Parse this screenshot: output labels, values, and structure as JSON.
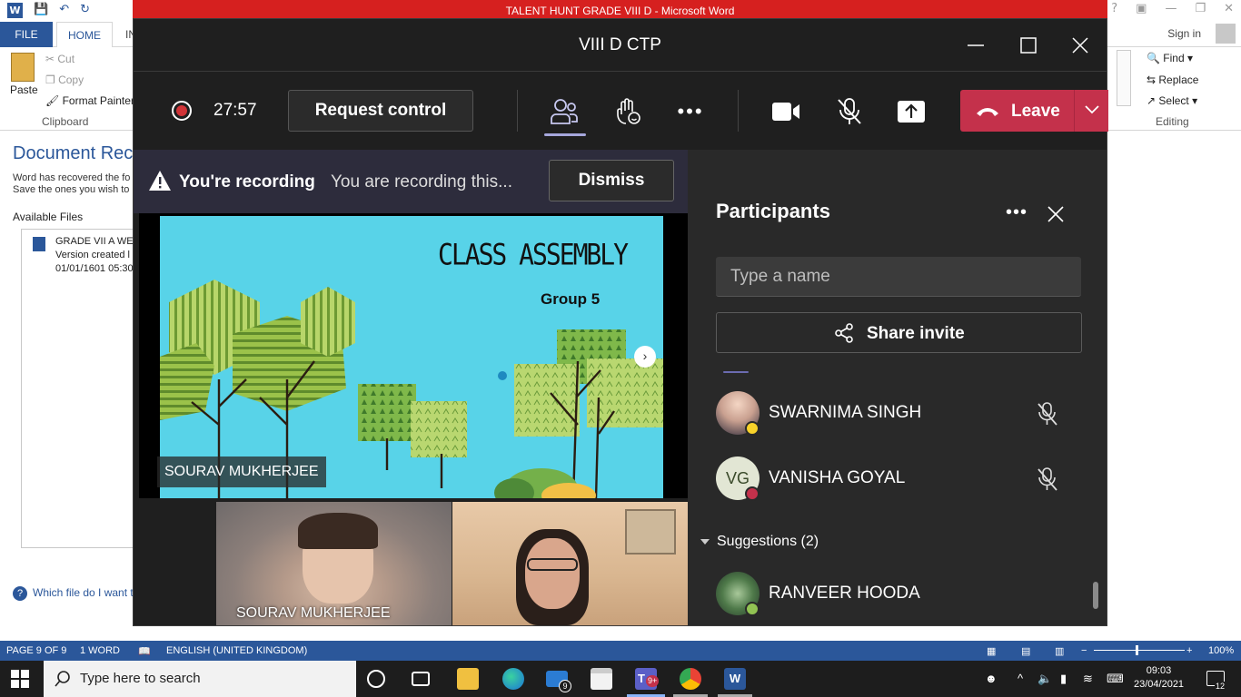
{
  "word": {
    "title": "TALENT HUNT GRADE VIII D -  Microsoft Word",
    "tabs": {
      "file": "FILE",
      "home": "HOME",
      "insert_partial": "IN"
    },
    "signin": "Sign in",
    "clipboard": {
      "paste": "Paste",
      "cut": "Cut",
      "copy": "Copy",
      "format_painter": "Format Painter",
      "group_label": "Clipboard"
    },
    "editing": {
      "find": "Find",
      "replace": "Replace",
      "select": "Select",
      "group_label": "Editing"
    },
    "recovery": {
      "title": "Document Rec",
      "text_line1": "Word has recovered the fo",
      "text_line2": "Save the ones you wish to",
      "available": "Available Files",
      "file_name": "GRADE VII A WEE",
      "file_version": "Version created l",
      "file_date": "01/01/1601 05:30",
      "help": "Which file do I want t"
    },
    "status": {
      "page": "PAGE 9 OF 9",
      "words": "1 WORD",
      "language": "ENGLISH (UNITED KINGDOM)",
      "zoom": "100%"
    }
  },
  "teams": {
    "window_title": "VIII D CTP",
    "timer": "27:57",
    "request_control": "Request control",
    "leave": "Leave",
    "recording_banner": {
      "bold": "You're recording",
      "text": "You are recording this...",
      "dismiss": "Dismiss"
    },
    "slide": {
      "title": "CLASS ASSEMBLY",
      "subtitle": "Group 5",
      "presenter": "SOURAV MUKHERJEE"
    },
    "videos": [
      {
        "name": "SOURAV MUKHERJEE"
      },
      {
        "name": ""
      }
    ],
    "participants": {
      "title": "Participants",
      "search_placeholder": "Type a name",
      "share_invite": "Share invite",
      "list": [
        {
          "name": "SWARNIMA SINGH",
          "initials": "",
          "status_color": "#f8d22a"
        },
        {
          "name": "VANISHA GOYAL",
          "initials": "VG",
          "status_color": "#c4314b"
        }
      ],
      "suggestions_label": "Suggestions (2)",
      "suggestions": [
        {
          "name": "RANVEER HOODA",
          "status_color": "#92c353"
        }
      ]
    }
  },
  "taskbar": {
    "search_placeholder": "Type here to search",
    "mail_badge": "9",
    "teams_badge": "9+",
    "time": "09:03",
    "date": "23/04/2021",
    "notifications": "12"
  }
}
